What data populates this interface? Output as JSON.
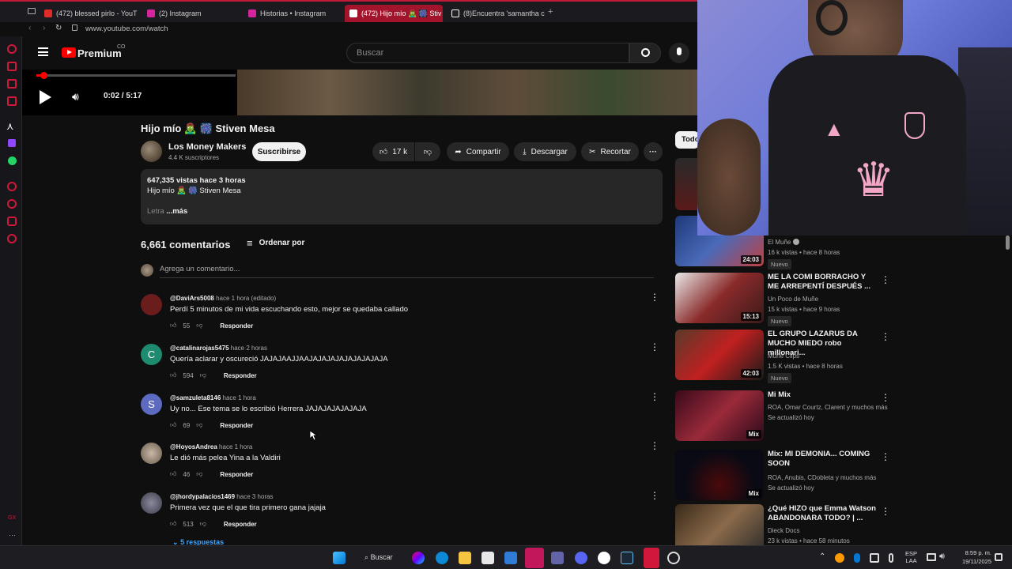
{
  "browser": {
    "tabs": [
      {
        "label": "(472) blessed pirlo - YouT",
        "color": "#e02b2b"
      },
      {
        "label": "(2) Instagram",
        "color": "#d6249f"
      },
      {
        "label": "Historias • Instagram",
        "color": "#d6249f"
      },
      {
        "label": "(472) Hijo mío 🧟‍♂️ 🎆 Stiv",
        "color": "#e02b2b"
      },
      {
        "label": "(8)Encuentra 'samantha c",
        "color": "#ffffff"
      }
    ],
    "url": "www.youtube.com/watch"
  },
  "header": {
    "logo": "Premium",
    "logo_suffix": "CO",
    "search_placeholder": "Buscar"
  },
  "player": {
    "time": "0:02 / 5:17",
    "progress_fraction": 0.006
  },
  "video": {
    "title": "Hijo mío 🧟‍♂️ 🎆 Stiven Mesa",
    "channel": "Los Money Makers",
    "subscribers": "4.4 K suscriptores",
    "subscribe_label": "Suscribirse",
    "likes": "17 k",
    "share_label": "Compartir",
    "download_label": "Descargar",
    "clip_label": "Recortar"
  },
  "description": {
    "stats": "647,335 vistas  hace 3 horas",
    "line1": "Hijo mío 🧟‍♂️ 🎆 Stiven Mesa",
    "letra": "Letra",
    "more": "...más"
  },
  "comments_section": {
    "count": "6,661 comentarios",
    "sort_label": "Ordenar por",
    "add_placeholder": "Agrega un comentario...",
    "reply_label": "Responder",
    "replies_link": "5 respuestas",
    "items": [
      {
        "author": "@DaviArs5008",
        "time": "hace 1 hora (editado)",
        "text": "Perdí 5 minutos de mi vida escuchando esto, mejor se quedaba callado",
        "likes": "55",
        "avatar_letter": "",
        "avatar_color": "#6b1d1d"
      },
      {
        "author": "@catalinarojas5475",
        "time": "hace 2 horas",
        "text": "Quería aclarar y oscureció JAJAJAAJJAAJAJAJAJAJAJAJAJAJA",
        "likes": "594",
        "avatar_letter": "C",
        "avatar_color": "#1e8a6e"
      },
      {
        "author": "@samzuleta8146",
        "time": "hace 1 hora",
        "text": "Uy no... Ese tema se lo escribió Herrera JAJAJAJAJAJAJA",
        "likes": "69",
        "avatar_letter": "S",
        "avatar_color": "#5c6bc0"
      },
      {
        "author": "@HoyosAndrea",
        "time": "hace 1 hora",
        "text": "Le dió más pelea Yina a la Valdiri",
        "likes": "46",
        "avatar_letter": "",
        "avatar_color": "#9c8a7a"
      },
      {
        "author": "@jhordypalacios1469",
        "time": "hace 3 horas",
        "text": "Primera vez que el que tira primero gana jajaja",
        "likes": "513",
        "avatar_letter": "",
        "avatar_color": "#4a4a5a"
      }
    ]
  },
  "recommendations": {
    "chip_label": "Todo",
    "items": [
      {
        "title": "",
        "channel": "El Muñe",
        "stats": "16 k vistas • hace 8 horas",
        "badge": "Nuevo",
        "duration": "24:03",
        "thumb": "#2a4a8a"
      },
      {
        "title": "ME LA COMI BORRACHO Y ME ARREPENTÍ DESPUÉS ...",
        "channel": "Un Poco de Muñe",
        "stats": "15 k vistas • hace 9 horas",
        "badge": "Nuevo",
        "duration": "15:13",
        "thumb": "#7a1a1a"
      },
      {
        "title": "EL GRUPO LAZARUS DA MUCHO MIEDO robo millonari...",
        "channel": "Muñe Clips",
        "stats": "1.5 K vistas • hace 8 horas",
        "badge": "Nuevo",
        "duration": "42:03",
        "thumb": "#5a2a2a"
      },
      {
        "title": "Mi Mix",
        "channel": "ROA, Omar Courtz, Clarent y muchos más",
        "stats": "Se actualizó hoy",
        "badge": "",
        "duration": "Mix",
        "thumb": "#6a1a2a"
      },
      {
        "title": "Mix: MI DEMONIA... COMING SOON",
        "channel": "ROA, Anubis, CDobleta y muchos más",
        "stats": "Se actualizó hoy",
        "badge": "",
        "duration": "Mix",
        "thumb": "#1a1a2a"
      },
      {
        "title": "¿Qué HIZO que Emma Watson ABANDONARA TODO? | ...",
        "channel": "Dieck Docs",
        "stats": "23 k vistas • hace 58 minutos",
        "badge": "",
        "duration": "",
        "thumb": "#4a3a2a"
      }
    ]
  },
  "taskbar": {
    "search_label": "Buscar",
    "lang_top": "ESP",
    "lang_bottom": "LAA",
    "time": "8:59 p. m.",
    "date": "19/11/2025"
  },
  "sidebar": {
    "bottom_label": "GX"
  },
  "colors": {
    "accent": "#ff0000",
    "opera_red": "#d1173a",
    "bg": "#0f0f0f"
  }
}
